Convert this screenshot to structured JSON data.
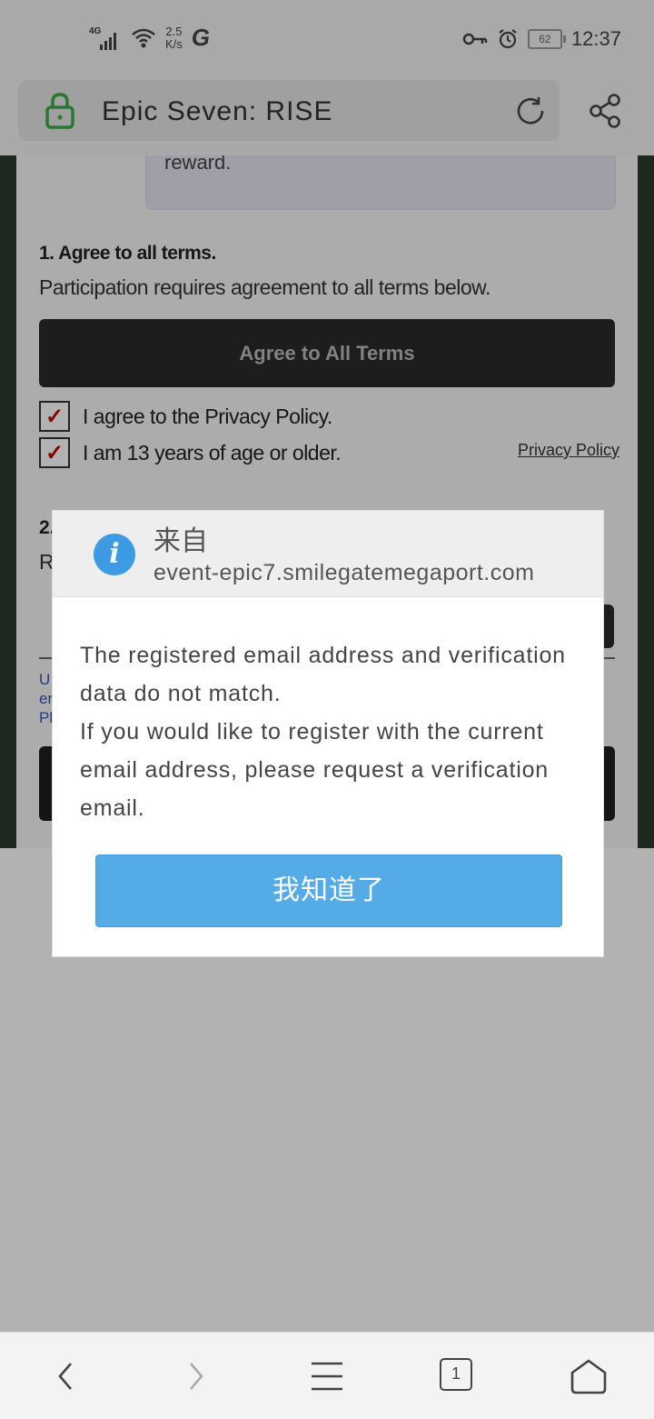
{
  "status_bar": {
    "network": "4G",
    "speed_value": "2.5",
    "speed_unit": "K/s",
    "battery": "62",
    "time": "12:37"
  },
  "browser": {
    "title": "Epic Seven: RISE"
  },
  "page": {
    "reward_text": "reward.",
    "section1_title": "1. Agree to all terms.",
    "section1_desc": "Participation requires agreement to all terms below.",
    "agree_all_label": "Agree to All Terms",
    "checkboxes": [
      {
        "label": "I agree to the Privacy Policy.",
        "checked": true
      },
      {
        "label": "I am 13 years of age or older.",
        "checked": true
      }
    ],
    "privacy_link": "Privacy Policy",
    "section2_num": "2.",
    "section2_r": "R",
    "blue_text_lines": [
      "U",
      "er",
      "Pl"
    ]
  },
  "dialog": {
    "from_label": "来自",
    "domain": "event-epic7.smilegatemegaport.com",
    "message": "The registered email address and verification data do not match.\nIf you would like to register with the current email address, please request a verification email.",
    "ok_button": "我知道了"
  },
  "nav": {
    "tab_count": "1"
  }
}
